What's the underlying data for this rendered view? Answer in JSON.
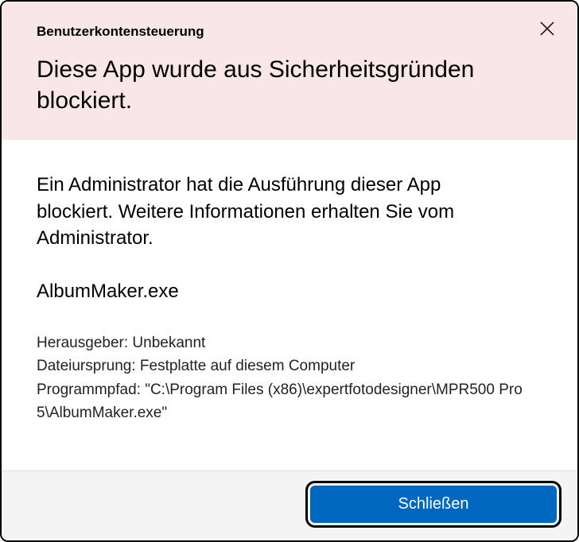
{
  "header": {
    "uac_label": "Benutzerkontensteuerung",
    "headline": "Diese App wurde aus Sicherheitsgründen blockiert."
  },
  "body": {
    "admin_message": "Ein Administrator hat die Ausführung dieser App blockiert. Weitere Informationen erhalten Sie vom Administrator.",
    "app_name": "AlbumMaker.exe",
    "publisher_line": "Herausgeber: Unbekannt",
    "origin_line": "Dateiursprung: Festplatte auf diesem Computer",
    "path_line": "Programmpfad: \"C:\\Program Files (x86)\\expertfotodesigner\\MPR500 Pro 5\\AlbumMaker.exe\""
  },
  "footer": {
    "close_label": "Schließen"
  }
}
